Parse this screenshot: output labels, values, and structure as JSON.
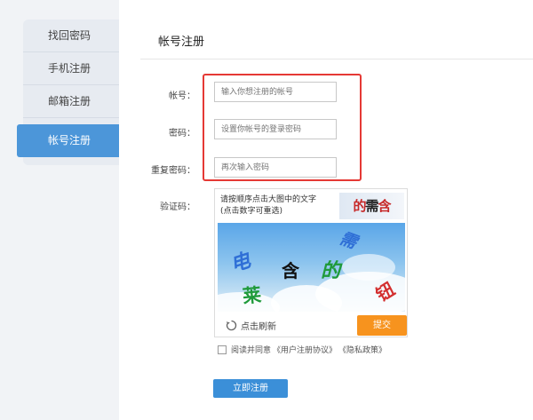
{
  "sidebar": {
    "items": [
      {
        "label": "找回密码",
        "active": false
      },
      {
        "label": "手机注册",
        "active": false
      },
      {
        "label": "邮箱注册",
        "active": false
      },
      {
        "label": "帐号注册",
        "active": true
      }
    ]
  },
  "main": {
    "title": "帐号注册",
    "fields": {
      "account": {
        "label": "帐号：",
        "placeholder": "输入你想注册的帐号"
      },
      "password": {
        "label": "密码：",
        "placeholder": "设置你帐号的登录密码"
      },
      "confirm": {
        "label": "重复密码：",
        "placeholder": "再次输入密码"
      }
    },
    "captcha": {
      "label": "验证码：",
      "instruction_line1": "请按顺序点击大图中的文字",
      "instruction_line2": "(点击数字可重选)",
      "target_chars": [
        "的",
        "需",
        "含"
      ],
      "image_chars": [
        {
          "text": "电",
          "color": "#2f6fd6"
        },
        {
          "text": "含",
          "color": "#111111"
        },
        {
          "text": "的",
          "color": "#1f9a3a"
        },
        {
          "text": "需",
          "color": "#2f6fd6"
        },
        {
          "text": "莱",
          "color": "#1f9a3a"
        },
        {
          "text": "钮",
          "color": "#d32f2f"
        }
      ],
      "refresh_label": "点击刷新",
      "submit_label": "提交"
    },
    "agreement": {
      "prefix": "阅读并同意",
      "user_agreement": "《用户注册协议》",
      "privacy_policy": "《隐私政策》"
    },
    "register_label": "立即注册"
  },
  "colors": {
    "accent": "#4c96d9",
    "highlight_border": "#e53935",
    "submit": "#f7931e"
  }
}
